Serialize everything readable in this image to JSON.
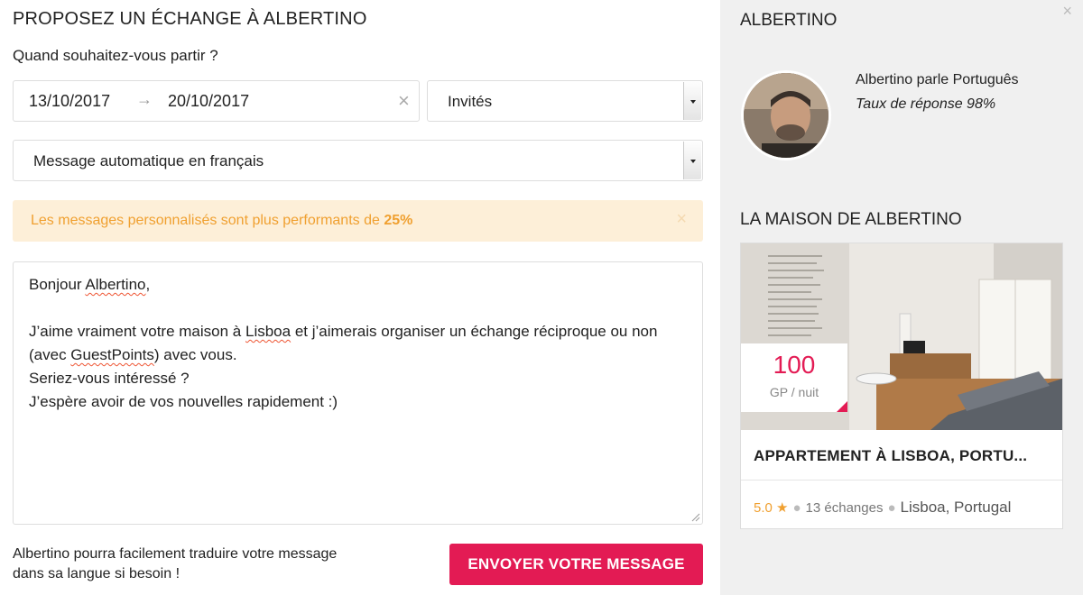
{
  "form": {
    "title": "PROPOSEZ UN ÉCHANGE À ALBERTINO",
    "question": "Quand souhaitez-vous partir ?",
    "date_from": "13/10/2017",
    "date_arrow": "→",
    "date_to": "20/10/2017",
    "date_clear": "×",
    "guests_select": "Invités",
    "message_select": "Message automatique en français",
    "alert": {
      "text": "Les messages personnalisés sont plus performants de ",
      "highlight": "25%",
      "close": "×"
    },
    "message": {
      "greeting_prefix": "Bonjour ",
      "greeting_name": "Albertino",
      "greeting_suffix": ",",
      "line1_a": "J’aime vraiment votre maison à ",
      "line1_city": "Lisboa",
      "line1_b": " et j’aimerais organiser un échange réciproque ou non (avec ",
      "line1_gp": "GuestPoints",
      "line1_c": ") avec vous.",
      "line2": "Seriez-vous intéressé ?",
      "line3": "J’espère avoir de vos nouvelles rapidement :)"
    },
    "footnote": "Albertino pourra facilement traduire votre message dans sa langue si besoin !",
    "send_button": "ENVOYER VOTRE MESSAGE"
  },
  "host": {
    "close": "×",
    "name": "ALBERTINO",
    "language": "Albertino parle Português",
    "response_rate": "Taux de réponse 98%"
  },
  "house": {
    "section_title": "LA MAISON DE ALBERTINO",
    "price": "100",
    "price_unit": "GP / nuit",
    "title": "APPARTEMENT À LISBOA, PORTU...",
    "rating": "5.0",
    "star": "★",
    "exchanges": "13 échanges",
    "location": "Lisboa, Portugal"
  },
  "colors": {
    "accent": "#e31b54",
    "alert_bg": "#fdefd8",
    "alert_text": "#f0a030",
    "sidebar_bg": "#f0f0f0"
  }
}
